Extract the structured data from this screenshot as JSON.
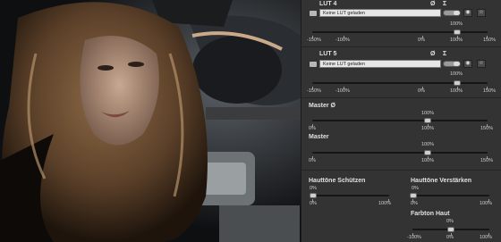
{
  "photo": {
    "description_icon": "portrait-photo"
  },
  "lut4": {
    "title": "LUT 4",
    "placeholder": "Keine LUT geladen",
    "sym_avg": "Ø",
    "sym_sum": "Σ",
    "value": "100%",
    "min": "-150%",
    "minus100": "-100%",
    "zero": "0%",
    "plus100": "100%",
    "max": "150%"
  },
  "lut5": {
    "title": "LUT 5",
    "placeholder": "Keine LUT geladen",
    "sym_avg": "Ø",
    "sym_sum": "Σ",
    "value": "100%",
    "min": "-150%",
    "minus100": "-100%",
    "zero": "0%",
    "plus100": "100%",
    "max": "150%"
  },
  "master_avg": {
    "title": "Master Ø",
    "value": "100%",
    "min": "0%",
    "mid": "100%",
    "max": "150%"
  },
  "master": {
    "title": "Master",
    "value": "100%",
    "min": "0%",
    "mid": "100%",
    "max": "150%"
  },
  "hauttoene_schuetzen": {
    "title": "Hauttöne Schützen",
    "value": "0%",
    "min": "0%",
    "max": "100%"
  },
  "hauttoene_verstaerken": {
    "title": "Hauttöne Verstärken",
    "value": "0%",
    "min": "0%",
    "max": "100%"
  },
  "farbton_haut": {
    "title": "Farbton Haut",
    "value": "0%",
    "min": "-100%",
    "zero": "0%",
    "max": "100%"
  }
}
